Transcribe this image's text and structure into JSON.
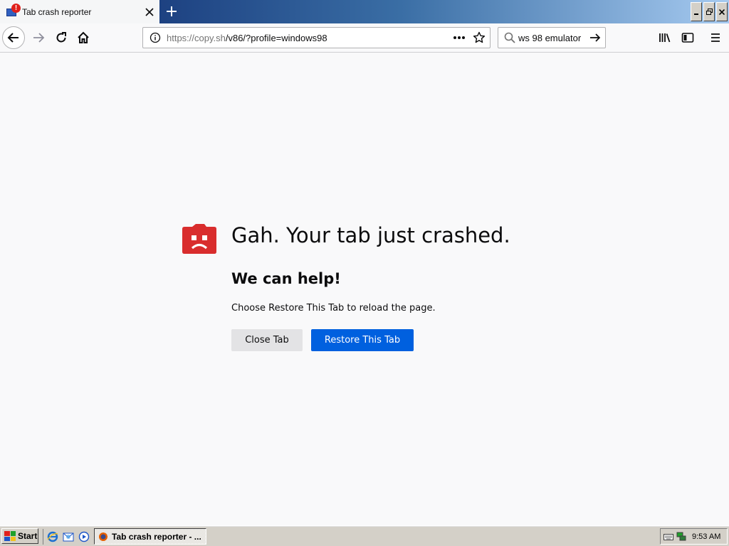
{
  "browser": {
    "tab": {
      "title": "Tab crash reporter",
      "favicon": "alert-monitor-icon"
    },
    "url": {
      "host": "https://copy.sh",
      "path": "/v86/?profile=windows98"
    },
    "search": {
      "value": "ws 98 emulator"
    },
    "window_controls": [
      "minimize",
      "restore",
      "close"
    ]
  },
  "crash_page": {
    "title": "Gah. Your tab just crashed.",
    "help_heading": "We can help!",
    "help_text": "Choose Restore This Tab to reload the page.",
    "close_button": "Close Tab",
    "restore_button": "Restore This Tab",
    "icon": "sad-folder-icon",
    "accent_color": "#0060df",
    "icon_color": "#d92d2d"
  },
  "taskbar": {
    "start_label": "Start",
    "task_label": "Tab crash reporter - ...",
    "clock": "9:53 AM",
    "quick_launch": [
      "internet-explorer-icon",
      "outlook-express-icon",
      "media-player-icon"
    ]
  }
}
